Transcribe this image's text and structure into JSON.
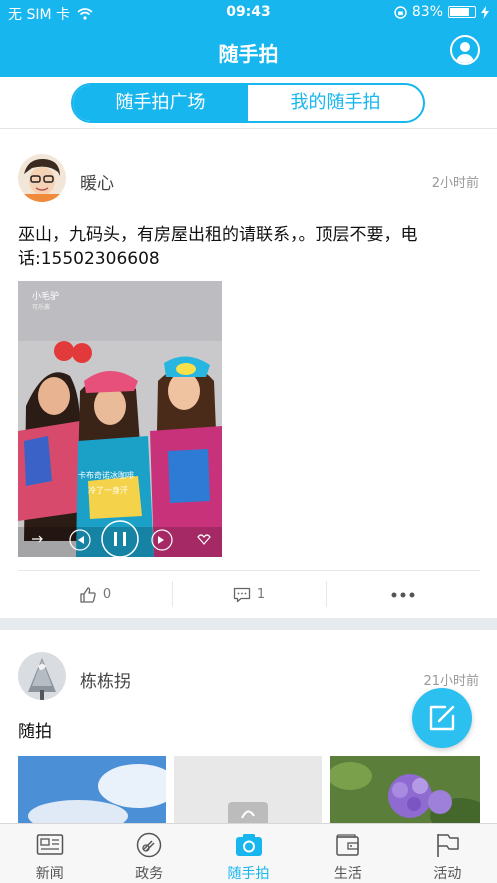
{
  "status_bar": {
    "carrier": "无 SIM 卡",
    "time": "09:43",
    "battery": "83%",
    "battery_level": 0.83
  },
  "header": {
    "title": "随手拍"
  },
  "segments": {
    "left": "随手拍广场",
    "right": "我的随手拍",
    "selected": "left"
  },
  "posts": [
    {
      "user": "暖心",
      "time": "2小时前",
      "text": "巫山，九码头，有房屋出租的请联系，。顶层不要，电话:15502306608",
      "likes": "0",
      "comments": "1"
    },
    {
      "user": "栋栋拐",
      "time": "21小时前",
      "text": "随拍"
    }
  ],
  "tabs": [
    {
      "label": "新闻",
      "icon": "news-icon"
    },
    {
      "label": "政务",
      "icon": "government-icon"
    },
    {
      "label": "随手拍",
      "icon": "camera-icon",
      "active": true
    },
    {
      "label": "生活",
      "icon": "wallet-icon"
    },
    {
      "label": "活动",
      "icon": "flag-icon"
    }
  ],
  "colors": {
    "accent": "#17b6ee",
    "fab": "#2cc0f0"
  }
}
